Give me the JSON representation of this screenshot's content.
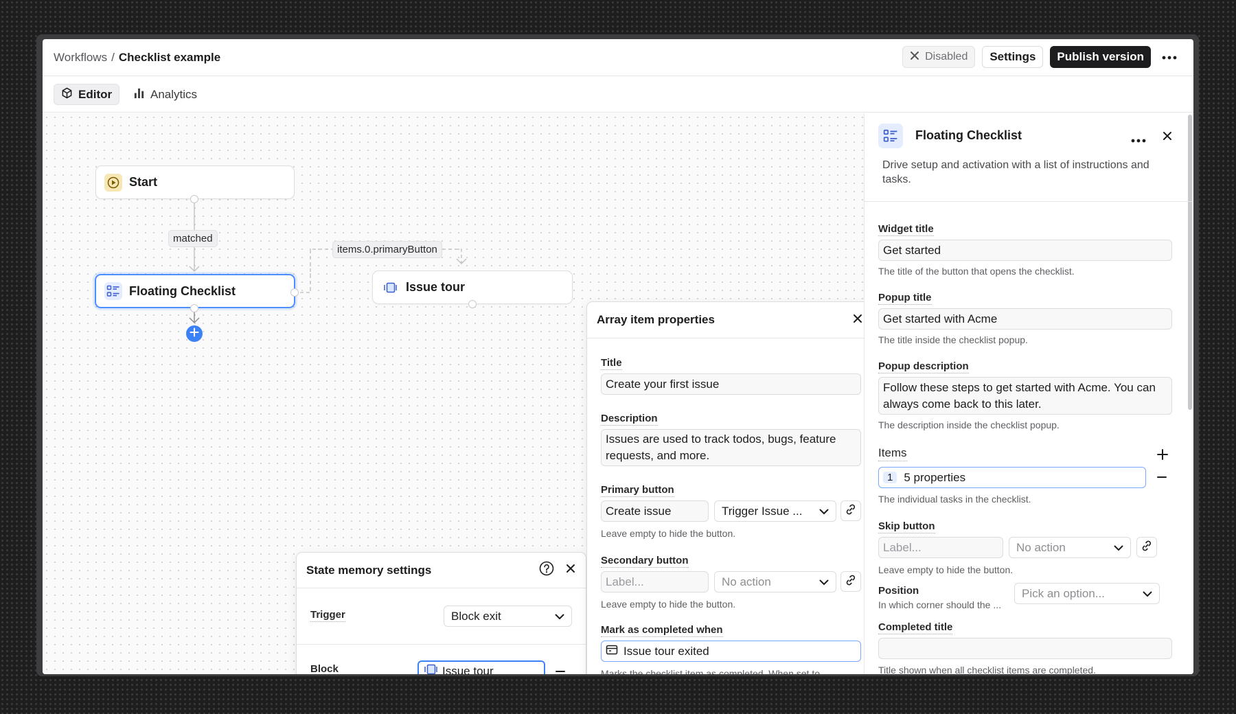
{
  "header": {
    "breadcrumb_root": "Workflows",
    "breadcrumb_sep": "/",
    "breadcrumb_current": "Checklist example",
    "disabled_label": "Disabled",
    "settings_label": "Settings",
    "publish_label": "Publish version"
  },
  "tabs": [
    {
      "label": "Editor",
      "icon": "cube-icon",
      "active": true
    },
    {
      "label": "Analytics",
      "icon": "bar-chart-icon",
      "active": false
    }
  ],
  "canvas": {
    "start_node": "Start",
    "edge_matched": "matched",
    "checklist_node": "Floating Checklist",
    "edge_primary": "items.0.primaryButton",
    "issue_tour_node": "Issue tour"
  },
  "array_item": {
    "title": "Array item properties",
    "title_label": "Title",
    "title_value": "Create your first issue",
    "desc_label": "Description",
    "desc_value": "Issues are used to track todos, bugs, feature requests, and more.",
    "primary_label": "Primary button",
    "primary_value": "Create issue",
    "primary_action": "Trigger Issue ...",
    "primary_help": "Leave empty to hide the button.",
    "secondary_label": "Secondary button",
    "secondary_placeholder": "Label...",
    "secondary_action": "No action",
    "secondary_help": "Leave empty to hide the button.",
    "completed_label": "Mark as completed when",
    "completed_value": "Issue tour exited",
    "completed_help": "Marks the checklist item as completed. When set to ..."
  },
  "state_memory": {
    "title": "State memory settings",
    "trigger_label": "Trigger",
    "trigger_value": "Block exit",
    "block_label": "Block",
    "block_value": "Issue tour"
  },
  "sidebar": {
    "title": "Floating Checklist",
    "description": "Drive setup and activation with a list of instructions and tasks.",
    "widget_title_label": "Widget title",
    "widget_title_value": "Get started",
    "widget_title_help": "The title of the button that opens the checklist.",
    "popup_title_label": "Popup title",
    "popup_title_value": "Get started with Acme",
    "popup_title_help": "The title inside the checklist popup.",
    "popup_desc_label": "Popup description",
    "popup_desc_value": "Follow these steps to get started with Acme. You can always come back to this later.",
    "popup_desc_help": "The description inside the checklist popup.",
    "items_label": "Items",
    "items_index": "1",
    "items_value": "5 properties",
    "items_help": "The individual tasks in the checklist.",
    "skip_label": "Skip button",
    "skip_placeholder": "Label...",
    "skip_action": "No action",
    "skip_help": "Leave empty to hide the button.",
    "position_label": "Position",
    "position_help": "In which corner should the ...",
    "position_placeholder": "Pick an option...",
    "completed_title_label": "Completed title",
    "completed_title_help": "Title shown when all checklist items are completed."
  },
  "colors": {
    "accent": "#3b82f6",
    "selected_border": "#4c8dff",
    "start_icon_bg": "#f7e7b5",
    "checklist_icon_bg": "#e4ecff"
  }
}
